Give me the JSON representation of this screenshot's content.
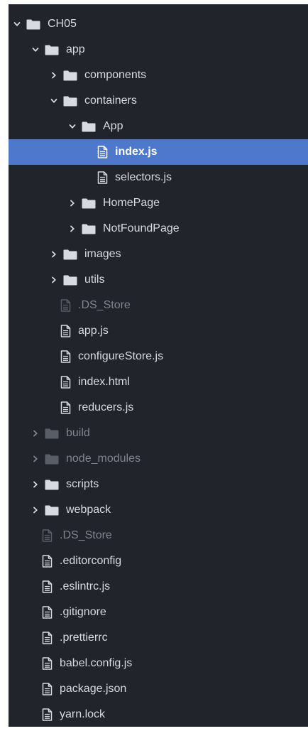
{
  "colors": {
    "panel_bg": "#21252b",
    "selected_bg": "#4d78cc",
    "text": "#d7dae0",
    "text_dim": "#7f848e",
    "text_selected": "#ffffff"
  },
  "tree": {
    "items": [
      {
        "label": "CH05",
        "type": "folder",
        "expanded": true,
        "depth": 0,
        "dim": false,
        "selected": false,
        "icon": "folder-icon"
      },
      {
        "label": "app",
        "type": "folder",
        "expanded": true,
        "depth": 1,
        "dim": false,
        "selected": false,
        "icon": "folder-icon"
      },
      {
        "label": "components",
        "type": "folder",
        "expanded": false,
        "depth": 2,
        "dim": false,
        "selected": false,
        "icon": "folder-icon"
      },
      {
        "label": "containers",
        "type": "folder",
        "expanded": true,
        "depth": 2,
        "dim": false,
        "selected": false,
        "icon": "folder-icon"
      },
      {
        "label": "App",
        "type": "folder",
        "expanded": true,
        "depth": 3,
        "dim": false,
        "selected": false,
        "icon": "folder-icon"
      },
      {
        "label": "index.js",
        "type": "file",
        "depth": 4,
        "dim": false,
        "selected": true,
        "icon": "file-icon"
      },
      {
        "label": "selectors.js",
        "type": "file",
        "depth": 4,
        "dim": false,
        "selected": false,
        "icon": "file-icon"
      },
      {
        "label": "HomePage",
        "type": "folder",
        "expanded": false,
        "depth": 3,
        "dim": false,
        "selected": false,
        "icon": "folder-icon"
      },
      {
        "label": "NotFoundPage",
        "type": "folder",
        "expanded": false,
        "depth": 3,
        "dim": false,
        "selected": false,
        "icon": "folder-icon"
      },
      {
        "label": "images",
        "type": "folder",
        "expanded": false,
        "depth": 2,
        "dim": false,
        "selected": false,
        "icon": "folder-icon"
      },
      {
        "label": "utils",
        "type": "folder",
        "expanded": false,
        "depth": 2,
        "dim": false,
        "selected": false,
        "icon": "folder-icon"
      },
      {
        "label": ".DS_Store",
        "type": "file",
        "depth": 2,
        "dim": true,
        "selected": false,
        "icon": "file-icon"
      },
      {
        "label": "app.js",
        "type": "file",
        "depth": 2,
        "dim": false,
        "selected": false,
        "icon": "file-icon"
      },
      {
        "label": "configureStore.js",
        "type": "file",
        "depth": 2,
        "dim": false,
        "selected": false,
        "icon": "file-icon"
      },
      {
        "label": "index.html",
        "type": "file",
        "depth": 2,
        "dim": false,
        "selected": false,
        "icon": "file-icon"
      },
      {
        "label": "reducers.js",
        "type": "file",
        "depth": 2,
        "dim": false,
        "selected": false,
        "icon": "file-icon"
      },
      {
        "label": "build",
        "type": "folder",
        "expanded": false,
        "depth": 1,
        "dim": true,
        "selected": false,
        "icon": "folder-icon"
      },
      {
        "label": "node_modules",
        "type": "folder",
        "expanded": false,
        "depth": 1,
        "dim": true,
        "selected": false,
        "icon": "folder-icon"
      },
      {
        "label": "scripts",
        "type": "folder",
        "expanded": false,
        "depth": 1,
        "dim": false,
        "selected": false,
        "icon": "folder-icon"
      },
      {
        "label": "webpack",
        "type": "folder",
        "expanded": false,
        "depth": 1,
        "dim": false,
        "selected": false,
        "icon": "folder-icon"
      },
      {
        "label": ".DS_Store",
        "type": "file",
        "depth": 1,
        "dim": true,
        "selected": false,
        "icon": "file-icon"
      },
      {
        "label": ".editorconfig",
        "type": "file",
        "depth": 1,
        "dim": false,
        "selected": false,
        "icon": "file-icon"
      },
      {
        "label": ".eslintrc.js",
        "type": "file",
        "depth": 1,
        "dim": false,
        "selected": false,
        "icon": "file-icon"
      },
      {
        "label": ".gitignore",
        "type": "file",
        "depth": 1,
        "dim": false,
        "selected": false,
        "icon": "file-icon"
      },
      {
        "label": ".prettierrc",
        "type": "file",
        "depth": 1,
        "dim": false,
        "selected": false,
        "icon": "file-icon"
      },
      {
        "label": "babel.config.js",
        "type": "file",
        "depth": 1,
        "dim": false,
        "selected": false,
        "icon": "file-icon"
      },
      {
        "label": "package.json",
        "type": "file",
        "depth": 1,
        "dim": false,
        "selected": false,
        "icon": "file-icon"
      },
      {
        "label": "yarn.lock",
        "type": "file",
        "depth": 1,
        "dim": false,
        "selected": false,
        "icon": "file-icon"
      }
    ]
  }
}
